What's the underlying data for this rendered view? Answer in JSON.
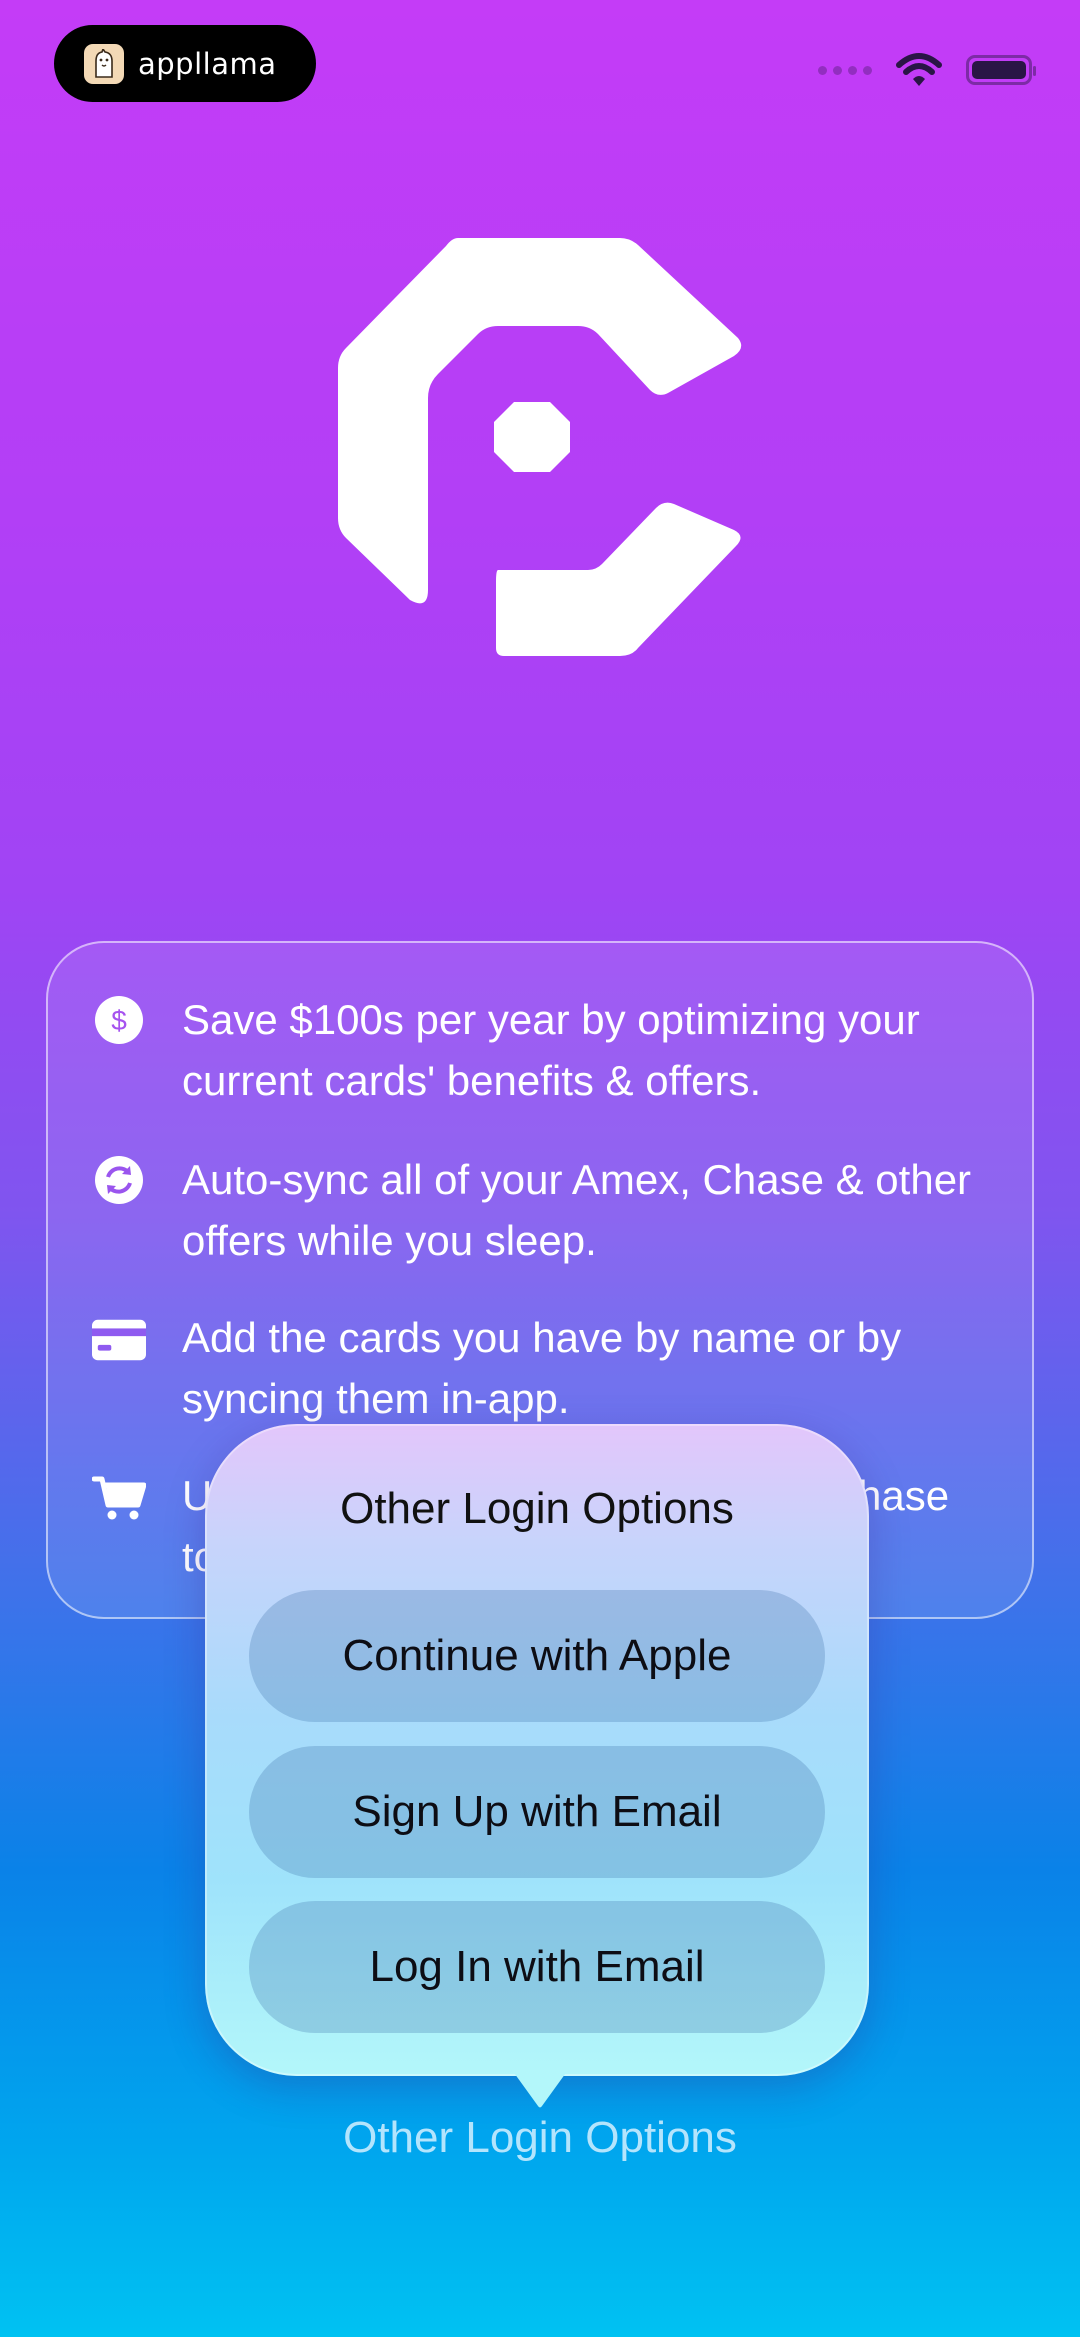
{
  "status_bar": {
    "brand": "appllama"
  },
  "features": [
    {
      "icon": "dollar-circle-icon",
      "text": "Save $100s per year by optimizing your current cards' benefits & offers."
    },
    {
      "icon": "sync-icon",
      "text": "Auto-sync all of your Amex, Chase & other offers while you sleep."
    },
    {
      "icon": "credit-card-icon",
      "text": "Add the cards you have by name or by syncing them in-app."
    },
    {
      "icon": "cart-icon",
      "text": "U",
      "text_tail": "hase",
      "text2": "to"
    }
  ],
  "popup": {
    "title": "Other Login Options",
    "buttons": [
      "Continue with Apple",
      "Sign Up with Email",
      "Log In with Email"
    ]
  },
  "bottom_link": "Other Login Options",
  "colors": {
    "background_top": "#c43cf7",
    "background_bottom": "#00c2f2",
    "popup_top": "#e3c6fb",
    "popup_bottom": "#b3f7fa"
  }
}
